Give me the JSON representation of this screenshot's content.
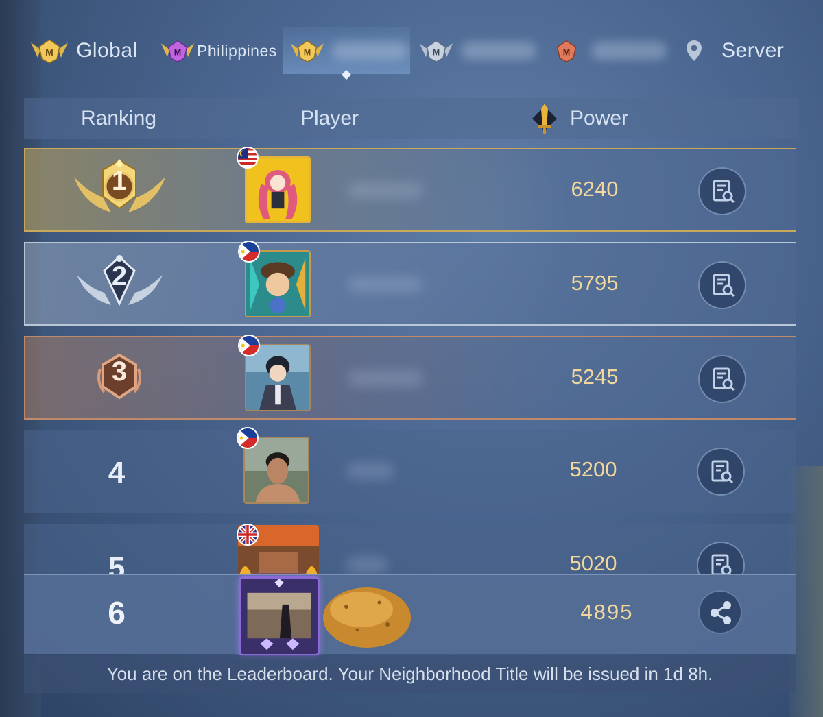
{
  "tabs": [
    {
      "label": "Global",
      "emblem": "gold-m-emblem",
      "state": "inactive"
    },
    {
      "label": "Philippines",
      "emblem": "purple-m-emblem",
      "state": "inactive"
    },
    {
      "label": "",
      "emblem": "gold-m-emblem",
      "state": "active"
    },
    {
      "label": "",
      "emblem": "silver-m-emblem",
      "state": "inactive"
    },
    {
      "label": "",
      "emblem": "red-m-emblem",
      "state": "inactive"
    },
    {
      "label": "Server",
      "emblem": "location-pin-icon",
      "state": "inactive"
    }
  ],
  "header": {
    "ranking": "Ranking",
    "player": "Player",
    "power": "Power"
  },
  "rows": [
    {
      "rank": "1",
      "flag": "malaysia",
      "power": "6240",
      "style": "gold"
    },
    {
      "rank": "2",
      "flag": "philippines",
      "power": "5795",
      "style": "silver"
    },
    {
      "rank": "3",
      "flag": "philippines",
      "power": "5245",
      "style": "bronze"
    },
    {
      "rank": "4",
      "flag": "philippines",
      "power": "5200",
      "style": "plain"
    },
    {
      "rank": "5",
      "flag": "united-kingdom",
      "power": "5020",
      "style": "plain"
    }
  ],
  "self": {
    "rank": "6",
    "power": "4895"
  },
  "footer": {
    "notice": "You are on the Leaderboard. Your Neighborhood Title will be issued in 1d 8h."
  },
  "colors": {
    "power_text": "#f1d79b",
    "gold": "#e4b43b",
    "silver": "#b8c6d8",
    "bronze": "#c08a6a"
  }
}
